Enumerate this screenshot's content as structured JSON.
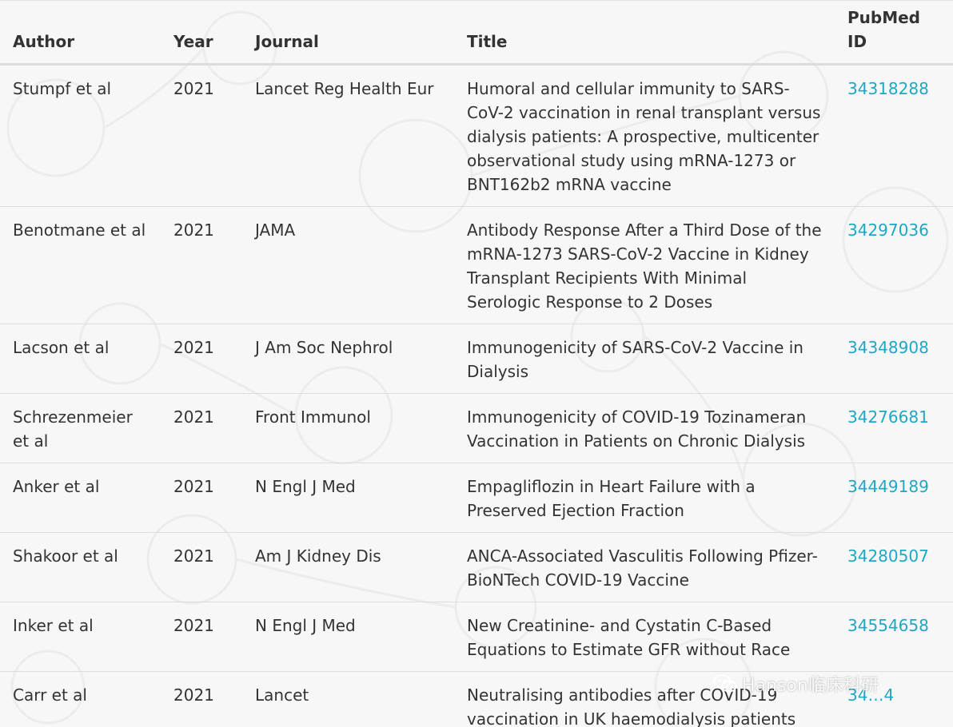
{
  "table": {
    "headers": {
      "author": "Author",
      "year": "Year",
      "journal": "Journal",
      "title": "Title",
      "pmid": "PubMed ID"
    },
    "rows": [
      {
        "author": "Stumpf et al",
        "year": "2021",
        "journal": "Lancet Reg Health Eur",
        "title": "Humoral and cellular immunity to SARS-CoV-2 vaccination in renal transplant versus dialysis patients: A prospective, multicenter observational study using mRNA-1273 or BNT162b2 mRNA vaccine",
        "pmid": "34318288"
      },
      {
        "author": "Benotmane et al",
        "year": "2021",
        "journal": "JAMA",
        "title": "Antibody Response After a Third Dose of the mRNA-1273 SARS-CoV-2 Vaccine in Kidney Transplant Recipients With Minimal Serologic Response to 2 Doses",
        "pmid": "34297036"
      },
      {
        "author": "Lacson et al",
        "year": "2021",
        "journal": "J Am Soc Nephrol",
        "title": "Immunogenicity of SARS-CoV-2 Vaccine in Dialysis",
        "pmid": "34348908"
      },
      {
        "author": "Schrezenmeier et al",
        "year": "2021",
        "journal": "Front Immunol",
        "title": "Immunogenicity of COVID-19 Tozinameran Vaccination in Patients on Chronic Dialysis",
        "pmid": "34276681"
      },
      {
        "author": "Anker et al",
        "year": "2021",
        "journal": "N Engl J Med",
        "title": "Empagliflozin in Heart Failure with a Preserved Ejection Fraction",
        "pmid": "34449189"
      },
      {
        "author": "Shakoor et al",
        "year": "2021",
        "journal": "Am J Kidney Dis",
        "title": "ANCA-Associated Vasculitis Following Pfizer-BioNTech COVID-19 Vaccine",
        "pmid": "34280507"
      },
      {
        "author": "Inker et al",
        "year": "2021",
        "journal": "N Engl J Med",
        "title": "New Creatinine- and Cystatin C-Based Equations to Estimate GFR without Race",
        "pmid": "34554658"
      },
      {
        "author": "Carr et al",
        "year": "2021",
        "journal": "Lancet",
        "title": "Neutralising antibodies after COVID-19 vaccination in UK haemodialysis patients",
        "pmid": "34…4"
      }
    ]
  },
  "watermark": {
    "text": "Hanson临床科研",
    "icon": "wechat-icon"
  },
  "colors": {
    "link": "#1ea8c4",
    "text": "#333333",
    "background": "#f7f7f7"
  }
}
